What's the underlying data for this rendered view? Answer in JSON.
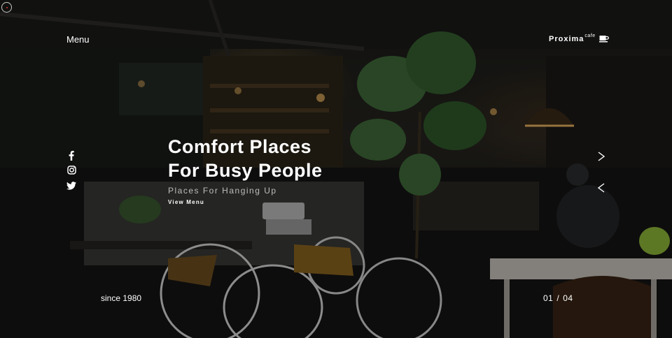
{
  "header": {
    "menu_label": "Menu"
  },
  "brand": {
    "name": "Proxima",
    "suffix": "cafe",
    "icon": "coffee-cup-icon"
  },
  "social": [
    {
      "name": "facebook",
      "icon": "facebook-icon"
    },
    {
      "name": "instagram",
      "icon": "instagram-icon"
    },
    {
      "name": "twitter",
      "icon": "twitter-icon"
    }
  ],
  "hero": {
    "title_line1": "Comfort Places",
    "title_line2": "For Busy People",
    "subtitle": "Places For Hanging Up",
    "cta": "View Menu"
  },
  "slider": {
    "next_icon": "chevron-right-icon",
    "prev_icon": "chevron-left-icon",
    "current": "01",
    "separator": "/",
    "total": "04"
  },
  "footer": {
    "since": "since 1980"
  },
  "colors": {
    "text": "#ffffff",
    "subtitle": "#bdbdbd",
    "lamp": "#e8b260",
    "plant": "#3f6a3a"
  }
}
